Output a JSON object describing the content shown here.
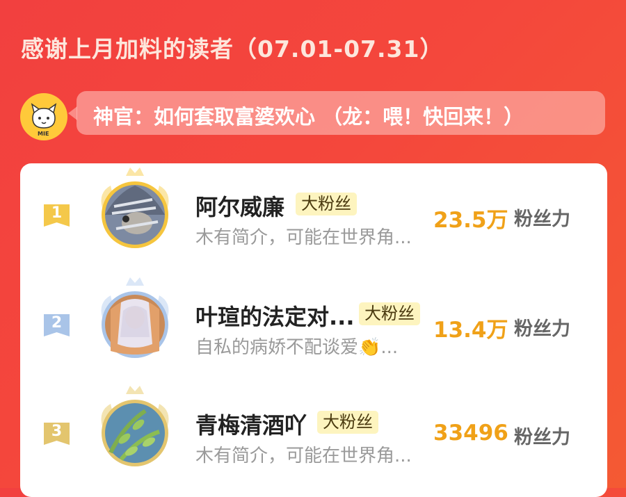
{
  "header": {
    "title": "感谢上月加料的读者（07.01-07.31）"
  },
  "message": {
    "text": "神官：如何套取富婆欢心 （龙：喂！快回来！）",
    "mascot_label": "MIE"
  },
  "colors": {
    "background": "#f2403f",
    "score": "#f0a118",
    "badge_bg": "#fdf4bf",
    "gold": "#f4c84a",
    "silver": "#a9c4e8",
    "bronze": "#e3c56e"
  },
  "leaderboard": [
    {
      "rank": "1",
      "name": "阿尔威廉",
      "badge": "大粉丝",
      "bio": "木有简介，可能在世界角...",
      "score": "23.5万",
      "score_label": "粉丝力",
      "avatar_icon": "cat-avatar-icon"
    },
    {
      "rank": "2",
      "name": "叶瑄的法定对...",
      "badge": "大粉丝",
      "bio": "自私的病娇不配谈爱👏...",
      "score": "13.4万",
      "score_label": "粉丝力",
      "avatar_icon": "anime-character-avatar-icon"
    },
    {
      "rank": "3",
      "name": "青梅清酒吖",
      "badge": "大粉丝",
      "bio": "木有简介，可能在世界角...",
      "score": "33496",
      "score_label": "粉丝力",
      "avatar_icon": "leaves-avatar-icon"
    }
  ]
}
